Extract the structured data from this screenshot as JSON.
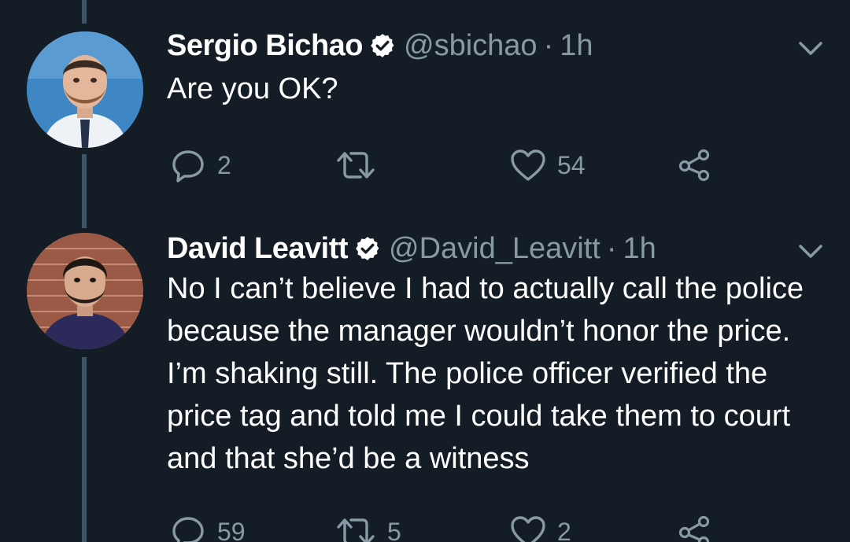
{
  "tweets": [
    {
      "name": "Sergio Bichao",
      "handle": "@sbichao",
      "separator": "·",
      "time": "1h",
      "text": "Are you OK?",
      "reply_count": "2",
      "retweet_count": "",
      "like_count": "54",
      "verified": true,
      "avatar": "person-photo"
    },
    {
      "name": "David Leavitt",
      "handle": "@David_Leavitt",
      "separator": "·",
      "time": "1h",
      "text": "No I can’t believe I had to actually call the police because the manager wouldn’t honor the price. I’m shaking still. The police officer verified the price tag and told me I could take them to court and that she’d be a witness",
      "reply_count": "59",
      "retweet_count": "5",
      "like_count": "2",
      "verified": true,
      "avatar": "person-photo"
    }
  ],
  "colors": {
    "background": "#141d26",
    "text": "#ffffff",
    "muted": "#8899a6",
    "thread_line": "#3d5466"
  },
  "icons": {
    "reply": "speech-bubble-icon",
    "retweet": "retweet-arrows-icon",
    "like": "heart-icon",
    "share": "share-nodes-icon",
    "verified": "verified-badge-icon",
    "menu": "chevron-down-icon"
  }
}
